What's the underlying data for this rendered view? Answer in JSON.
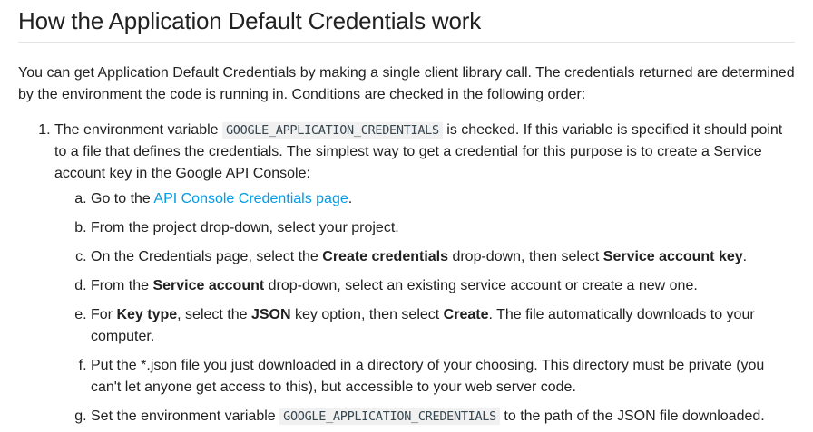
{
  "heading": "How the Application Default Credentials work",
  "intro": "You can get Application Default Credentials by making a single client library call. The credentials returned are determined by the environment the code is running in. Conditions are checked in the following order:",
  "step1": {
    "pre": "The environment variable ",
    "code": "GOOGLE_APPLICATION_CREDENTIALS",
    "post": " is checked. If this variable is specified it should point to a file that defines the credentials. The simplest way to get a credential for this purpose is to create a Service account key in the Google API Console:"
  },
  "substeps": {
    "a": {
      "pre": "Go to the ",
      "link": "API Console Credentials page",
      "post": "."
    },
    "b": {
      "text": "From the project drop-down, select your project."
    },
    "c": {
      "t1": "On the Credentials page, select the ",
      "b1": "Create credentials",
      "t2": " drop-down, then select ",
      "b2": "Service account key",
      "t3": "."
    },
    "d": {
      "t1": "From the ",
      "b1": "Service account",
      "t2": " drop-down, select an existing service account or create a new one."
    },
    "e": {
      "t1": "For ",
      "b1": "Key type",
      "t2": ", select the ",
      "b2": "JSON",
      "t3": " key option, then select ",
      "b3": "Create",
      "t4": ". The file automatically downloads to your computer."
    },
    "f": {
      "text": "Put the *.json file you just downloaded in a directory of your choosing. This directory must be private (you can't let anyone get access to this), but accessible to your web server code."
    },
    "g": {
      "pre": "Set the environment variable ",
      "code": "GOOGLE_APPLICATION_CREDENTIALS",
      "post": " to the path of the JSON file downloaded."
    }
  }
}
